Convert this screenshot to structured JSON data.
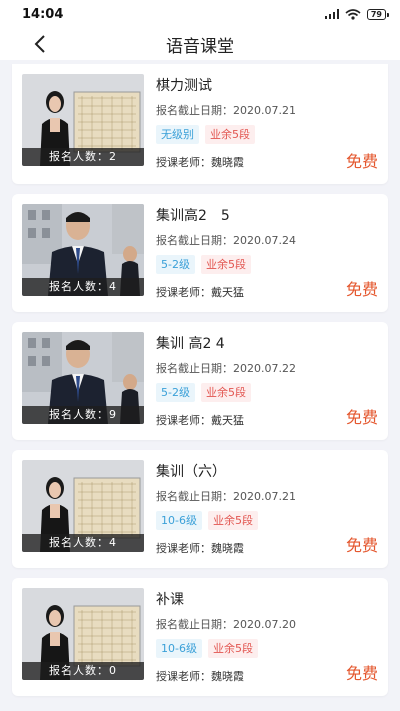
{
  "status": {
    "time": "14:04",
    "battery": "79"
  },
  "nav": {
    "title": "语音课堂"
  },
  "courses": [
    {
      "title": "棋力测试",
      "deadline": "报名截止日期：2020.07.21",
      "tag1": "无级别",
      "tag2": "业余5段",
      "teacher": "授课老师：魏晓霞",
      "price": "免费",
      "enroll": "报名人数：2"
    },
    {
      "title": "集训高2　5",
      "deadline": "报名截止日期：2020.07.24",
      "tag1": "5-2级",
      "tag2": "业余5段",
      "teacher": "授课老师：戴天猛",
      "price": "免费",
      "enroll": "报名人数：4"
    },
    {
      "title": "集训 高2 4",
      "deadline": "报名截止日期：2020.07.22",
      "tag1": "5-2级",
      "tag2": "业余5段",
      "teacher": "授课老师：戴天猛",
      "price": "免费",
      "enroll": "报名人数：9"
    },
    {
      "title": "集训（六）",
      "deadline": "报名截止日期：2020.07.21",
      "tag1": "10-6级",
      "tag2": "业余5段",
      "teacher": "授课老师：魏晓霞",
      "price": "免费",
      "enroll": "报名人数：4"
    },
    {
      "title": "补课",
      "deadline": "报名截止日期：2020.07.20",
      "tag1": "10-6级",
      "tag2": "业余5段",
      "teacher": "授课老师：魏晓霞",
      "price": "免费",
      "enroll": "报名人数：0"
    }
  ],
  "colors": {
    "price": "#e4572e",
    "tag_blue": "#3aa0d8",
    "tag_red": "#e25550"
  }
}
